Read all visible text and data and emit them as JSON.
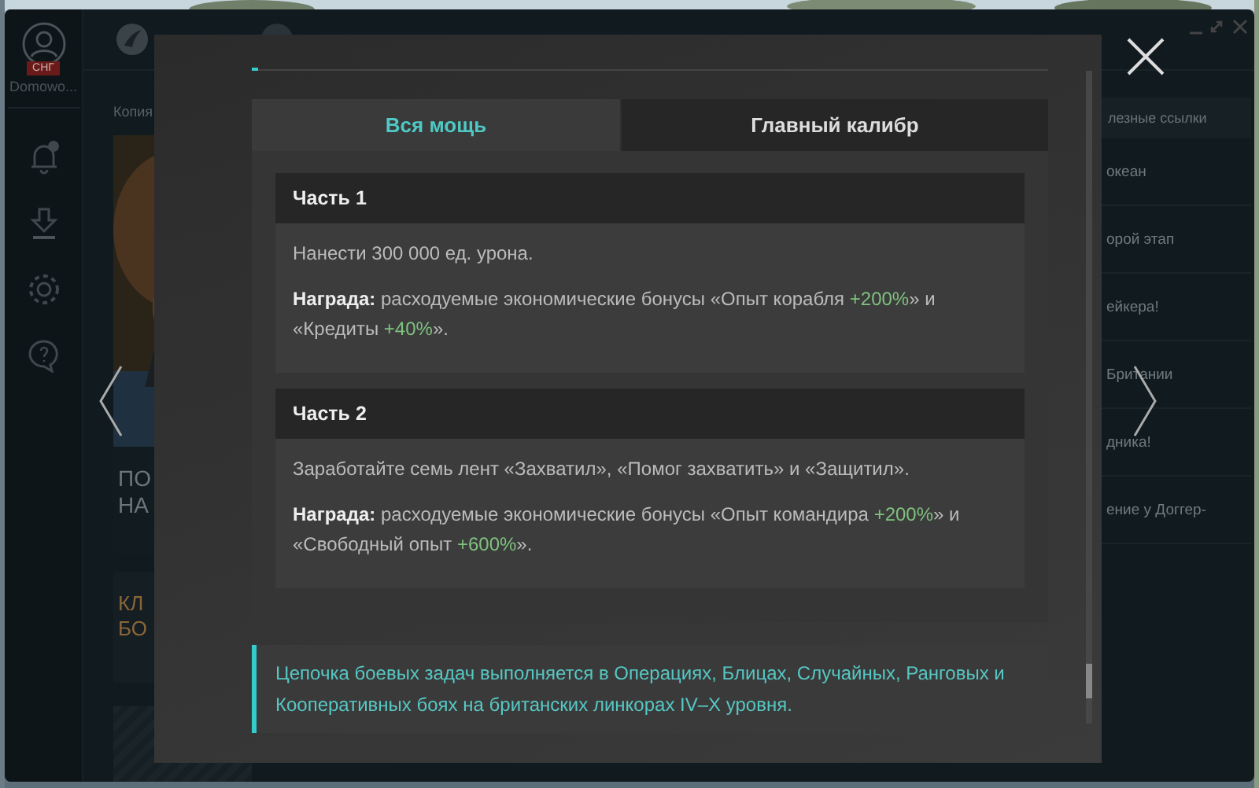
{
  "sidebar": {
    "region_badge": "СНГ",
    "username": "Domowo..."
  },
  "main": {
    "tab_label": "Копия",
    "feature_card": {
      "title_lines": [
        "ПО",
        "НА"
      ]
    },
    "promo_card": {
      "title_lines": [
        "КЛ",
        "БО"
      ]
    }
  },
  "links": {
    "dropdown": "лезные ссылки",
    "items": [
      {
        "text": "океан"
      },
      {
        "text": "орой этап"
      },
      {
        "text": "ейкера!"
      },
      {
        "text": "Британии"
      },
      {
        "text": "дника!"
      },
      {
        "text": "ение у Доггер-"
      }
    ]
  },
  "dialog": {
    "tabs": [
      {
        "label": "Вся мощь",
        "selected": true
      },
      {
        "label": "Главный калибр",
        "selected": false
      }
    ],
    "parts": [
      {
        "title": "Часть 1",
        "task": "Нанести 300 000 ед. урона.",
        "reward": [
          {
            "text": "**Награда:** расходуемые экономические бонусы «Опыт корабля ",
            "highlight": false
          },
          {
            "text": "+200%",
            "highlight": true
          },
          {
            "text": "» и «Кредиты ",
            "highlight": false
          },
          {
            "text": "+40%",
            "highlight": true
          },
          {
            "text": "».",
            "highlight": false
          }
        ]
      },
      {
        "title": "Часть 2",
        "task": "Заработайте семь лент «Захватил», «Помог захватить» и «Защитил».",
        "reward": [
          {
            "text": "**Награда:** расходуемые экономические бонусы «Опыт командира ",
            "highlight": false
          },
          {
            "text": "+200%",
            "highlight": true
          },
          {
            "text": "» и «Свободный опыт ",
            "highlight": false
          },
          {
            "text": "+600%",
            "highlight": true
          },
          {
            "text": "».",
            "highlight": false
          }
        ]
      }
    ],
    "note": "Цепочка боевых задач выполняется в Операциях, Блицах, Случайных, Ранговых и Кооперативных боях на британских линкорах IV–X уровня."
  }
}
